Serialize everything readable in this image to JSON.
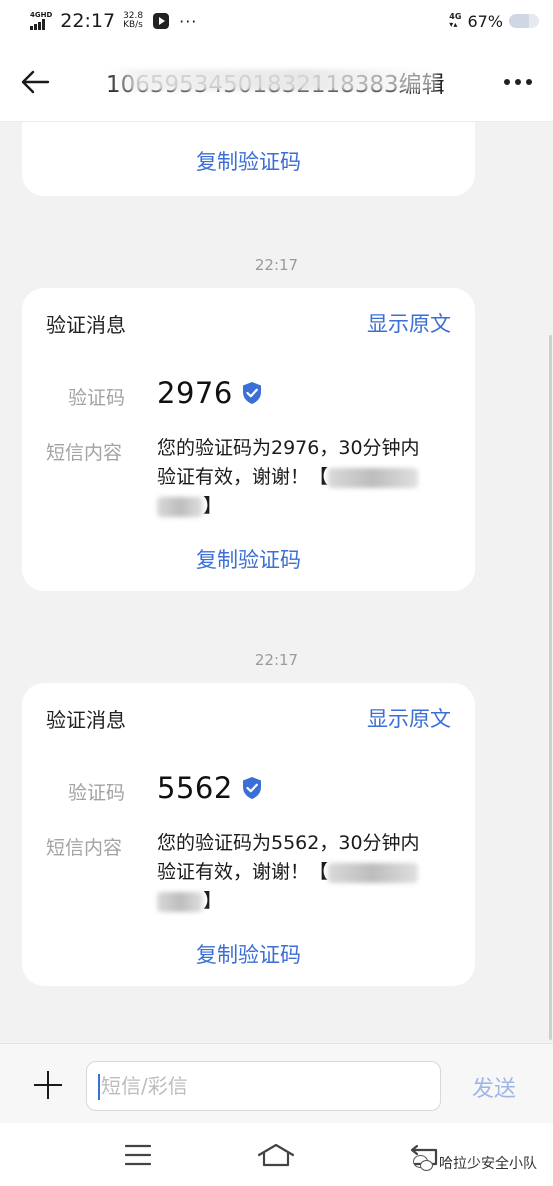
{
  "status_bar": {
    "network": "4GHD",
    "time": "22:17",
    "speed_value": "32.8",
    "speed_unit": "KB/s",
    "more": "···",
    "lte": "4G",
    "battery_pct": "67%",
    "battery_level": 0.67
  },
  "header": {
    "title": "10659534501832118",
    "title_tail": "383编辑",
    "back_icon": "arrow-left-icon",
    "more_icon": "more-dots-icon"
  },
  "partial_card": {
    "copy_label": "复制验证码"
  },
  "messages": [
    {
      "timestamp": "22:17",
      "card_title": "验证消息",
      "show_original": "显示原文",
      "code_label": "验证码",
      "code": "2976",
      "content_label": "短信内容",
      "content_line1": "您的验证码为2976，30分钟内",
      "content_line2": "验证有效，谢谢！【",
      "content_line3": "】",
      "copy_label": "复制验证码",
      "verified_icon": "verified-shield-icon"
    },
    {
      "timestamp": "22:17",
      "card_title": "验证消息",
      "show_original": "显示原文",
      "code_label": "验证码",
      "code": "5562",
      "content_label": "短信内容",
      "content_line1": "您的验证码为5562，30分钟内",
      "content_line2": "验证有效，谢谢！【",
      "content_line3": "】",
      "copy_label": "复制验证码",
      "verified_icon": "verified-shield-icon"
    }
  ],
  "compose": {
    "placeholder": "短信/彩信",
    "send_label": "发送",
    "plus_icon": "plus-icon"
  },
  "nav": {
    "menu_icon": "menu-icon",
    "home_icon": "home-icon",
    "back_icon": "back-nav-icon",
    "watermark": "哈拉少安全小队"
  },
  "colors": {
    "accent": "#3b6fd6",
    "background": "#f2f2f2",
    "card": "#ffffff",
    "label_gray": "#a3a3a3"
  }
}
